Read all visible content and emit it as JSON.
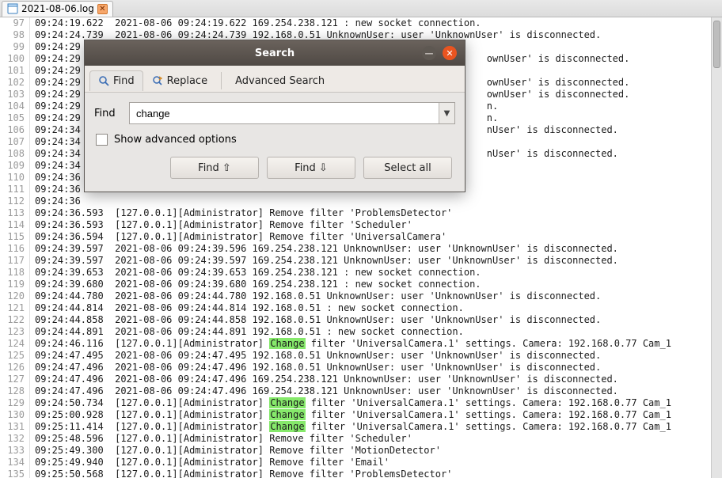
{
  "tab": {
    "filename": "2021-08-06.log"
  },
  "search": {
    "title": "Search",
    "tabs": {
      "find": "Find",
      "replace": "Replace",
      "advanced": "Advanced Search"
    },
    "find_label": "Find",
    "find_value": "change",
    "show_advanced": "Show advanced options",
    "buttons": {
      "find_prev": "Find ⇧",
      "find_next": "Find ⇩",
      "select_all": "Select all"
    }
  },
  "highlight_word": "Change",
  "lines": [
    {
      "n": 97,
      "t": "09:24:19.622  2021-08-06 09:24:19.622 169.254.238.121 : new socket connection."
    },
    {
      "n": 98,
      "t": "09:24:24.739  2021-08-06 09:24:24.739 192.168.0.51 UnknownUser: user 'UnknownUser' is disconnected."
    },
    {
      "n": 99,
      "t": "09:24:29"
    },
    {
      "n": 100,
      "t": "09:24:29                                                                       ownUser' is disconnected."
    },
    {
      "n": 101,
      "t": "09:24:29"
    },
    {
      "n": 102,
      "t": "09:24:29                                                                       ownUser' is disconnected."
    },
    {
      "n": 103,
      "t": "09:24:29                                                                       ownUser' is disconnected."
    },
    {
      "n": 104,
      "t": "09:24:29                                                                       n."
    },
    {
      "n": 105,
      "t": "09:24:29                                                                       n."
    },
    {
      "n": 106,
      "t": "09:24:34                                                                       nUser' is disconnected."
    },
    {
      "n": 107,
      "t": "09:24:34"
    },
    {
      "n": 108,
      "t": "09:24:34                                                                       nUser' is disconnected."
    },
    {
      "n": 109,
      "t": "09:24:34"
    },
    {
      "n": 110,
      "t": "09:24:36"
    },
    {
      "n": 111,
      "t": "09:24:36"
    },
    {
      "n": 112,
      "t": "09:24:36"
    },
    {
      "n": 113,
      "t": "09:24:36.593  [127.0.0.1][Administrator] Remove filter 'ProblemsDetector'"
    },
    {
      "n": 114,
      "t": "09:24:36.593  [127.0.0.1][Administrator] Remove filter 'Scheduler'"
    },
    {
      "n": 115,
      "t": "09:24:36.594  [127.0.0.1][Administrator] Remove filter 'UniversalCamera'"
    },
    {
      "n": 116,
      "t": "09:24:39.597  2021-08-06 09:24:39.596 169.254.238.121 UnknownUser: user 'UnknownUser' is disconnected."
    },
    {
      "n": 117,
      "t": "09:24:39.597  2021-08-06 09:24:39.597 169.254.238.121 UnknownUser: user 'UnknownUser' is disconnected."
    },
    {
      "n": 118,
      "t": "09:24:39.653  2021-08-06 09:24:39.653 169.254.238.121 : new socket connection."
    },
    {
      "n": 119,
      "t": "09:24:39.680  2021-08-06 09:24:39.680 169.254.238.121 : new socket connection."
    },
    {
      "n": 120,
      "t": "09:24:44.780  2021-08-06 09:24:44.780 192.168.0.51 UnknownUser: user 'UnknownUser' is disconnected."
    },
    {
      "n": 121,
      "t": "09:24:44.814  2021-08-06 09:24:44.814 192.168.0.51 : new socket connection."
    },
    {
      "n": 122,
      "t": "09:24:44.858  2021-08-06 09:24:44.858 192.168.0.51 UnknownUser: user 'UnknownUser' is disconnected."
    },
    {
      "n": 123,
      "t": "09:24:44.891  2021-08-06 09:24:44.891 192.168.0.51 : new socket connection."
    },
    {
      "n": 124,
      "t": "09:24:46.116  [127.0.0.1][Administrator] Change filter 'UniversalCamera.1' settings. Camera: 192.168.0.77 Cam_1"
    },
    {
      "n": 125,
      "t": "09:24:47.495  2021-08-06 09:24:47.495 192.168.0.51 UnknownUser: user 'UnknownUser' is disconnected."
    },
    {
      "n": 126,
      "t": "09:24:47.496  2021-08-06 09:24:47.496 192.168.0.51 UnknownUser: user 'UnknownUser' is disconnected."
    },
    {
      "n": 127,
      "t": "09:24:47.496  2021-08-06 09:24:47.496 169.254.238.121 UnknownUser: user 'UnknownUser' is disconnected."
    },
    {
      "n": 128,
      "t": "09:24:47.496  2021-08-06 09:24:47.496 169.254.238.121 UnknownUser: user 'UnknownUser' is disconnected."
    },
    {
      "n": 129,
      "t": "09:24:50.734  [127.0.0.1][Administrator] Change filter 'UniversalCamera.1' settings. Camera: 192.168.0.77 Cam_1"
    },
    {
      "n": 130,
      "t": "09:25:00.928  [127.0.0.1][Administrator] Change filter 'UniversalCamera.1' settings. Camera: 192.168.0.77 Cam_1"
    },
    {
      "n": 131,
      "t": "09:25:11.414  [127.0.0.1][Administrator] Change filter 'UniversalCamera.1' settings. Camera: 192.168.0.77 Cam_1"
    },
    {
      "n": 132,
      "t": "09:25:48.596  [127.0.0.1][Administrator] Remove filter 'Scheduler'"
    },
    {
      "n": 133,
      "t": "09:25:49.300  [127.0.0.1][Administrator] Remove filter 'MotionDetector'"
    },
    {
      "n": 134,
      "t": "09:25:49.940  [127.0.0.1][Administrator] Remove filter 'Email'"
    },
    {
      "n": 135,
      "t": "09:25:50.568  [127.0.0.1][Administrator] Remove filter 'ProblemsDetector'"
    }
  ]
}
